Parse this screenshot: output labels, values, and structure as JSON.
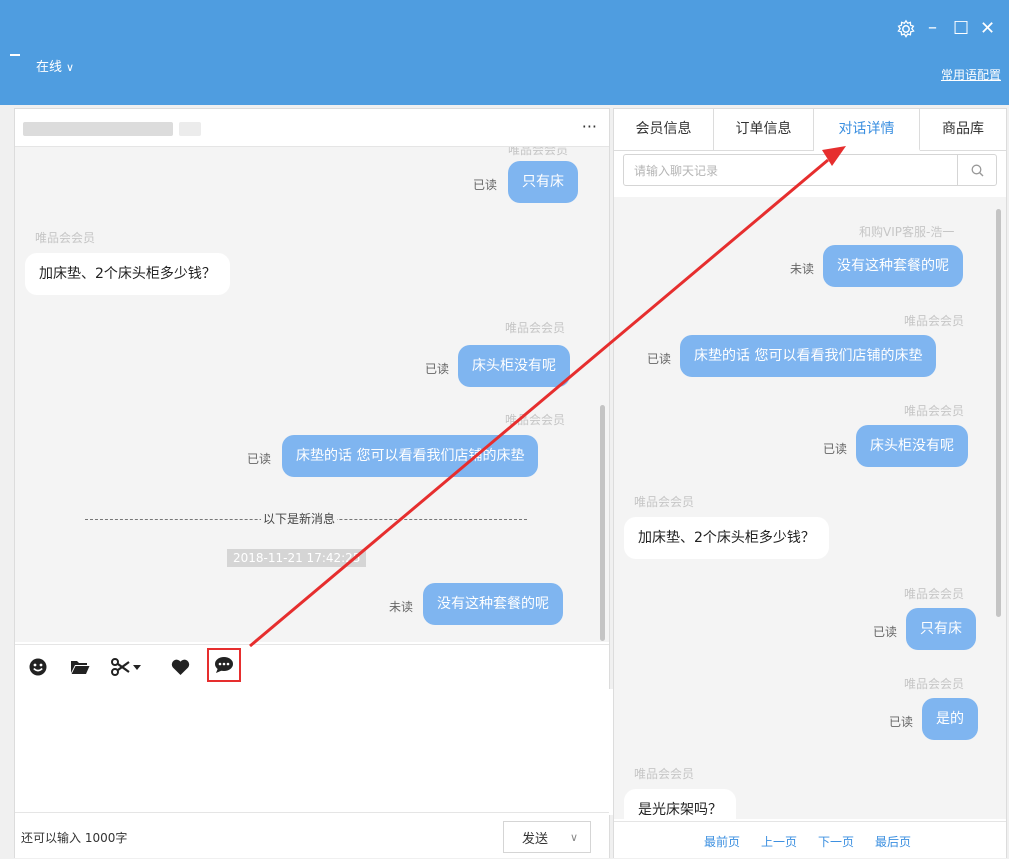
{
  "titlebar": {
    "status_label": "在线",
    "status_chevron": "∨",
    "settings_icon": "gear-icon",
    "minimize_glyph": "–",
    "maximize_glyph": "☐",
    "close_glyph": "✕",
    "common_phrases_link": "常用语配置",
    "background_color": "#4f9de0"
  },
  "chat": {
    "more_menu": "···",
    "messages": {
      "m1": {
        "sender": "唯品会会员",
        "read": "已读",
        "text": "只有床"
      },
      "m2": {
        "sender": "唯品会会员",
        "text": "加床垫、2个床头柜多少钱？"
      },
      "m3": {
        "sender": "唯品会会员",
        "read": "已读",
        "text": "床头柜没有呢"
      },
      "m4": {
        "sender": "唯品会会员",
        "read": "已读",
        "text": "床垫的话 您可以看看我们店铺的床垫"
      },
      "m5": {
        "read": "未读",
        "text": "没有这种套餐的呢"
      }
    },
    "new_message_divider": "以下是新消息",
    "timestamp": "2018-11-21 17:42:25",
    "toolbar": {
      "emoji_icon": "smiley-icon",
      "file_icon": "folder-icon",
      "screenshot_icon": "scissors-icon",
      "favorite_icon": "heart-icon",
      "quick_reply_icon": "chat-bubble-icon"
    },
    "remaining_chars": "还可以输入 1000字",
    "send_label": "发送",
    "send_chevron": "∨"
  },
  "right_panel": {
    "tabs": [
      "会员信息",
      "订单信息",
      "对话详情",
      "商品库"
    ],
    "active_tab": "对话详情",
    "search_placeholder": "请输入聊天记录",
    "history": {
      "h1": {
        "sender": "和购VIP客服-浩一",
        "read": "未读",
        "text": "没有这种套餐的呢"
      },
      "h2": {
        "sender": "唯品会会员",
        "read": "已读",
        "text": "床垫的话 您可以看看我们店铺的床垫"
      },
      "h3": {
        "sender": "唯品会会员",
        "read": "已读",
        "text": "床头柜没有呢"
      },
      "h4": {
        "sender": "唯品会会员",
        "text": "加床垫、2个床头柜多少钱？"
      },
      "h5": {
        "sender": "唯品会会员",
        "read": "已读",
        "text": "只有床"
      },
      "h6": {
        "sender": "唯品会会员",
        "read": "已读",
        "text": "是的"
      },
      "h7": {
        "sender": "唯品会会员",
        "text": "是光床架吗？"
      }
    },
    "pager": [
      "最前页",
      "上一页",
      "下一页",
      "最后页"
    ]
  },
  "colors": {
    "accent": "#3b8fe0",
    "bubble_out": "#7fb5f0",
    "annotation_red": "#e62e2e"
  }
}
